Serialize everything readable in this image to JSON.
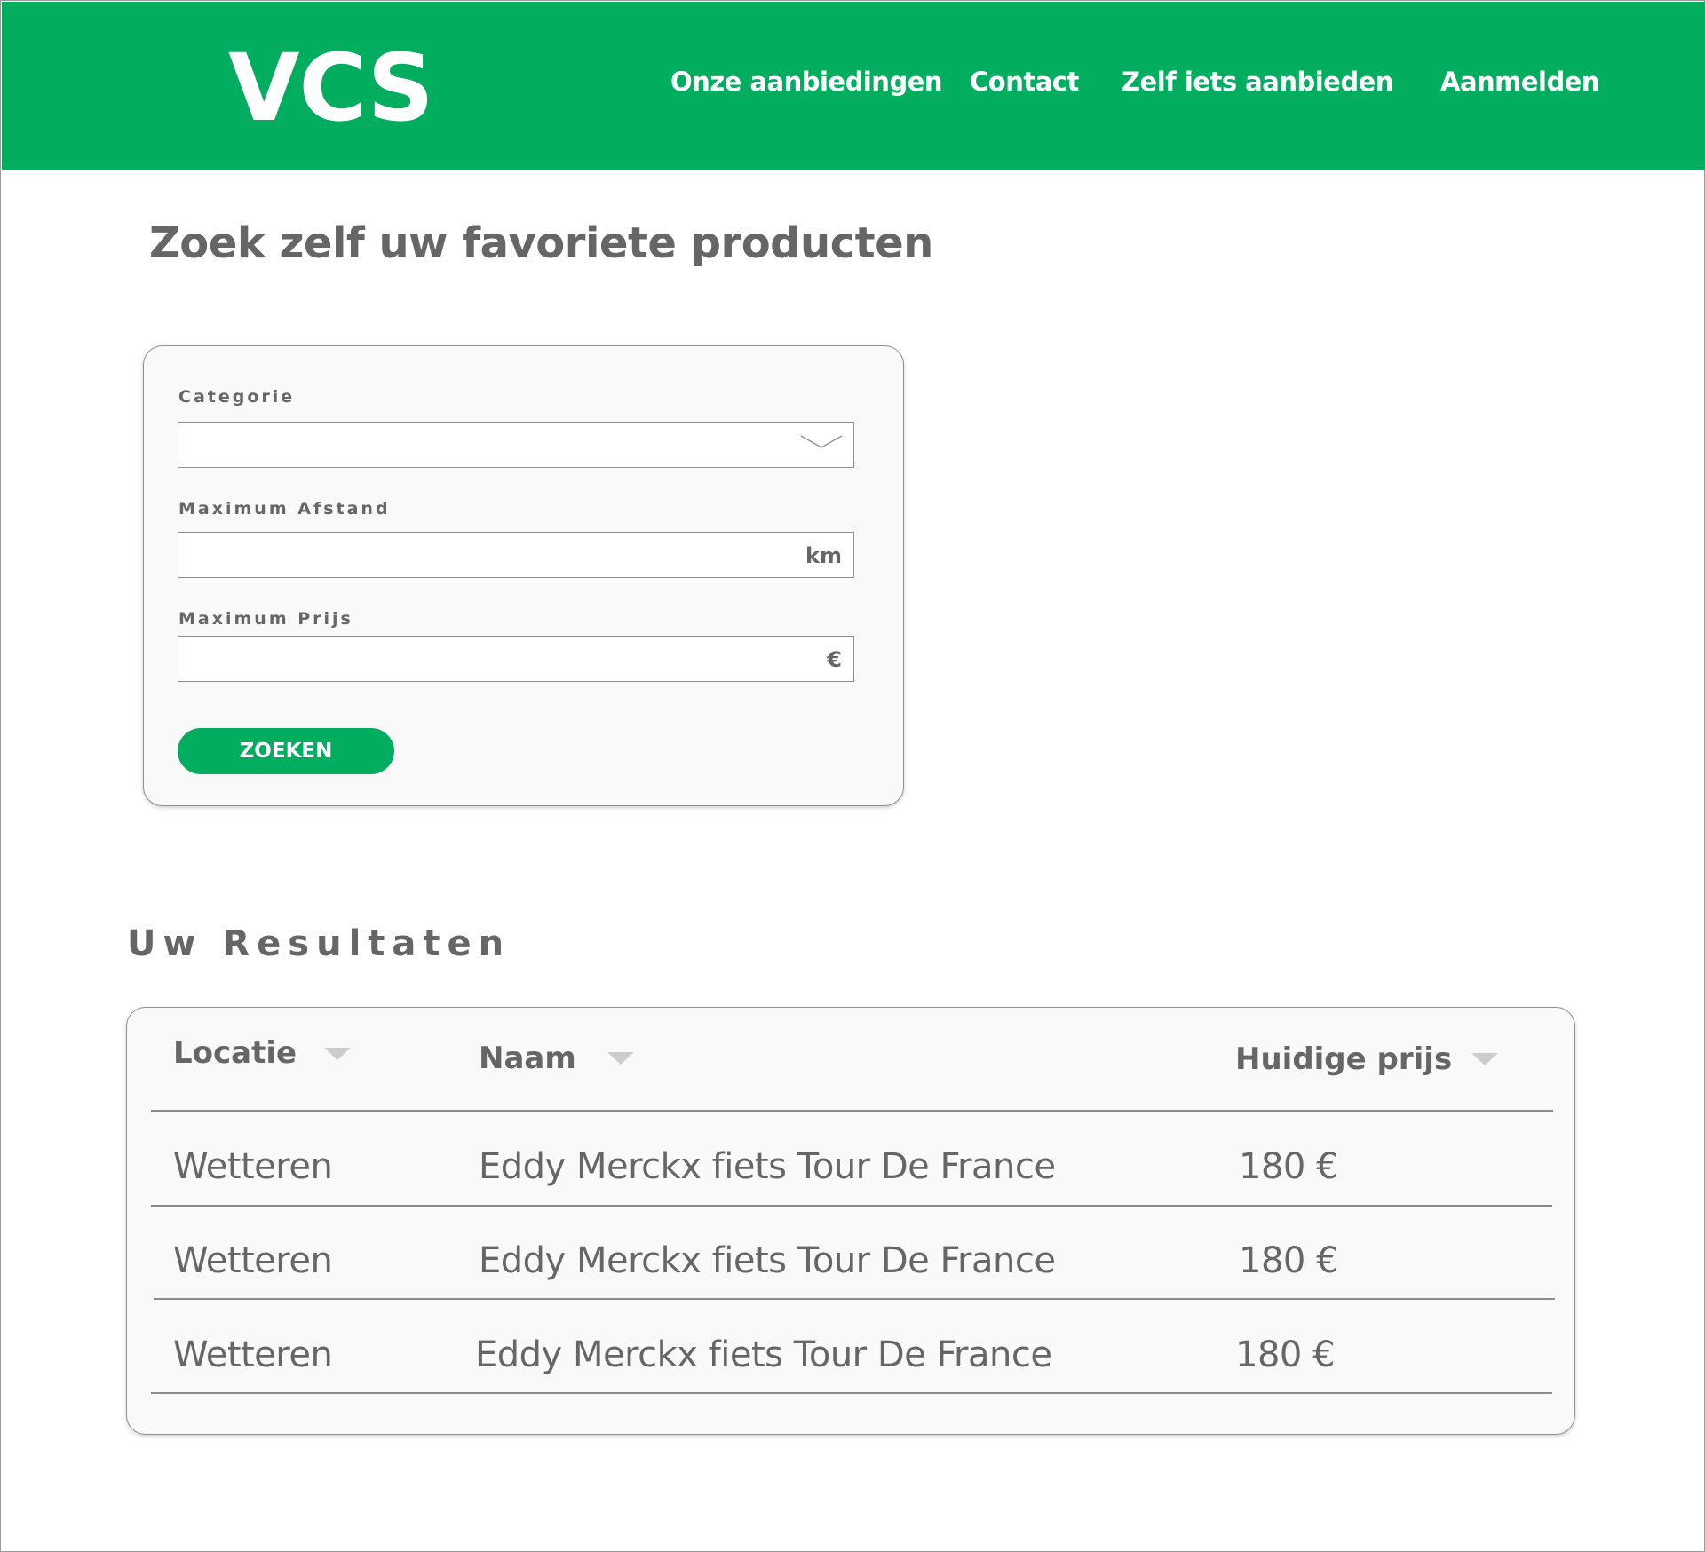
{
  "header": {
    "logo": "VCS",
    "nav": [
      "Onze aanbiedingen",
      "Contact",
      "Zelf iets aanbieden",
      "Aanmelden"
    ]
  },
  "page_title": "Zoek zelf uw favoriete producten",
  "search_form": {
    "category_label": "Categorie",
    "category_value": "",
    "distance_label": "Maximum Afstand",
    "distance_value": "",
    "distance_unit": "km",
    "price_label": "Maximum Prijs",
    "price_value": "",
    "price_unit": "€",
    "search_button": "ZOEKEN"
  },
  "results": {
    "title": "Uw Resultaten",
    "columns": [
      "Locatie",
      "Naam",
      "Huidige prijs"
    ],
    "rows": [
      [
        "Wetteren",
        "Eddy Merckx fiets Tour De France",
        "180 €"
      ],
      [
        "Wetteren",
        "Eddy Merckx fiets Tour De France",
        "180 €"
      ],
      [
        "Wetteren",
        "Eddy Merckx fiets Tour De France",
        "180 €"
      ]
    ]
  },
  "colors": {
    "brand_green": "#03ad5f",
    "text_gray": "#666666",
    "card_background": "#f9f9f9",
    "sort_icon": "#cccccc"
  },
  "icons": {
    "category_select": "chevron-down-icon",
    "column_sort": "sort-down-icon"
  }
}
